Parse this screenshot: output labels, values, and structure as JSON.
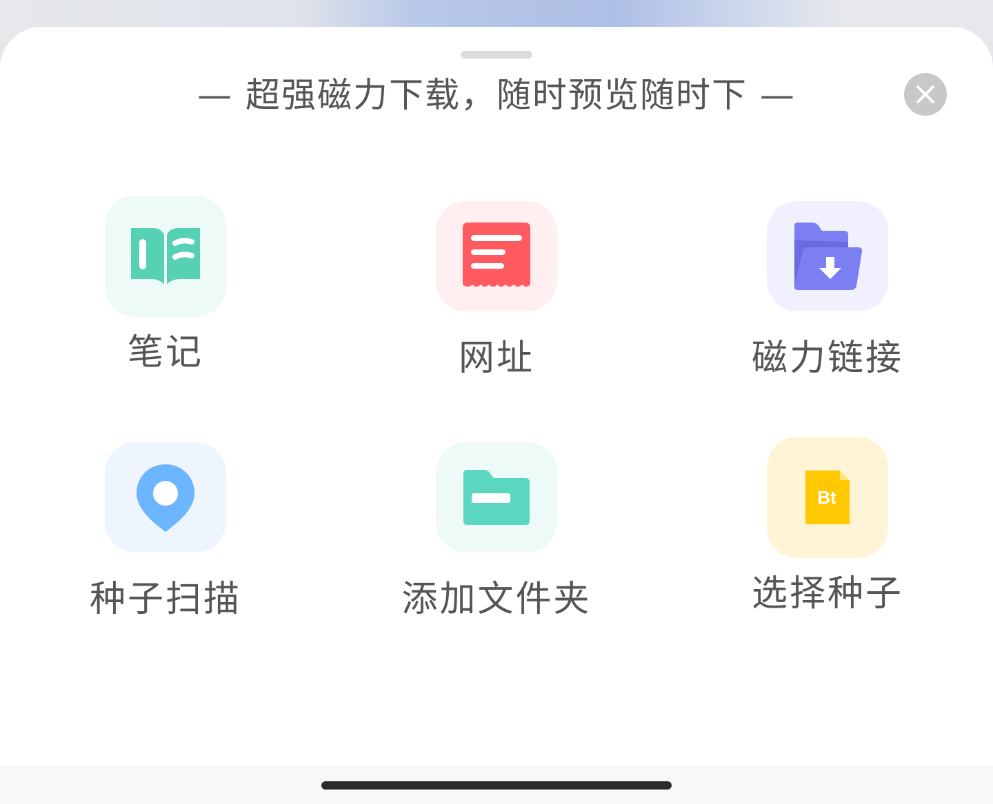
{
  "sheet": {
    "title": "— 超强磁力下载，随时预览随时下 —"
  },
  "actions": [
    {
      "label": "笔记",
      "icon": "book-icon",
      "tile_color": "#eefaf7",
      "icon_color": "#56d1b4"
    },
    {
      "label": "网址",
      "icon": "document-list-icon",
      "tile_color": "#ffeff0",
      "icon_color": "#ff5a5f"
    },
    {
      "label": "磁力链接",
      "icon": "folder-download-icon",
      "tile_color": "#f0f0ff",
      "icon_color": "#7b7ff2"
    },
    {
      "label": "种子扫描",
      "icon": "location-pin-icon",
      "tile_color": "#eef5ff",
      "icon_color": "#6cb6ff"
    },
    {
      "label": "添加文件夹",
      "icon": "folder-icon",
      "tile_color": "#eefaf7",
      "icon_color": "#5bd6c1"
    },
    {
      "label": "选择种子",
      "icon": "bt-file-icon",
      "tile_color": "#fff4d6",
      "icon_color": "#ffc800",
      "badge_text": "Bt"
    }
  ]
}
